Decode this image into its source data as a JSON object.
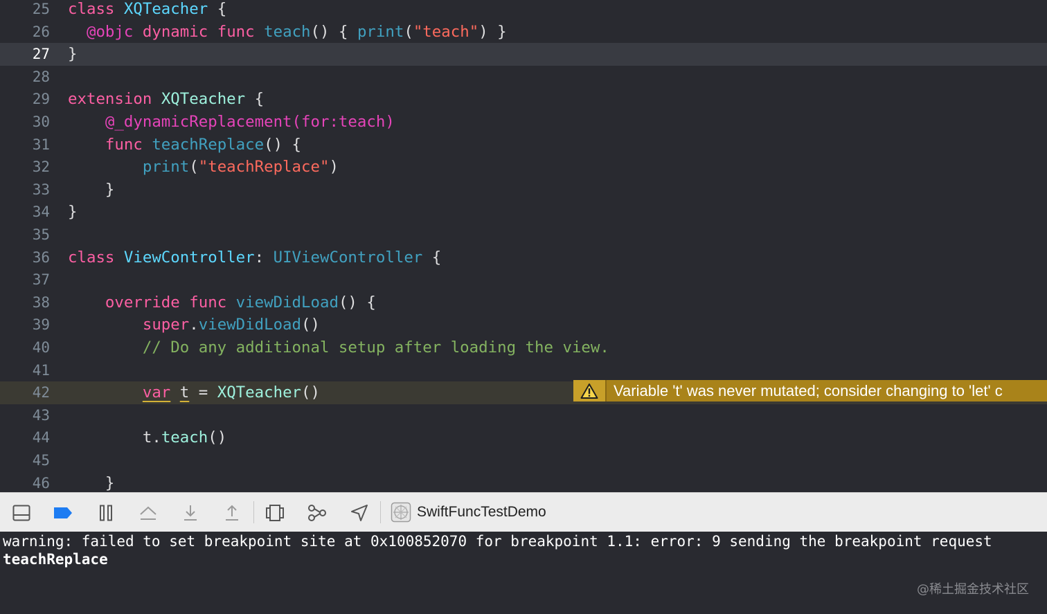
{
  "editor": {
    "lines": [
      {
        "num": "25",
        "tokens": [
          {
            "t": "class ",
            "c": "kw"
          },
          {
            "t": "XQTeacher",
            "c": "typedecl"
          },
          {
            "t": " {",
            "c": ""
          }
        ]
      },
      {
        "num": "26",
        "tokens": [
          {
            "t": "  ",
            "c": ""
          },
          {
            "t": "@objc",
            "c": "attr"
          },
          {
            "t": " ",
            "c": ""
          },
          {
            "t": "dynamic",
            "c": "kw"
          },
          {
            "t": " ",
            "c": ""
          },
          {
            "t": "func",
            "c": "kw"
          },
          {
            "t": " ",
            "c": ""
          },
          {
            "t": "teach",
            "c": "fnuse"
          },
          {
            "t": "() { ",
            "c": ""
          },
          {
            "t": "print",
            "c": "fnuse"
          },
          {
            "t": "(",
            "c": ""
          },
          {
            "t": "\"teach\"",
            "c": "str"
          },
          {
            "t": ") }",
            "c": ""
          }
        ]
      },
      {
        "num": "27",
        "tokens": [
          {
            "t": "}",
            "c": ""
          }
        ]
      },
      {
        "num": "28",
        "tokens": []
      },
      {
        "num": "29",
        "tokens": [
          {
            "t": "extension ",
            "c": "kw"
          },
          {
            "t": "XQTeacher",
            "c": "otype"
          },
          {
            "t": " {",
            "c": ""
          }
        ]
      },
      {
        "num": "30",
        "tokens": [
          {
            "t": "    ",
            "c": ""
          },
          {
            "t": "@_dynamicReplacement(for:teach)",
            "c": "attr"
          }
        ]
      },
      {
        "num": "31",
        "tokens": [
          {
            "t": "    ",
            "c": ""
          },
          {
            "t": "func",
            "c": "kw"
          },
          {
            "t": " ",
            "c": ""
          },
          {
            "t": "teachReplace",
            "c": "fnuse"
          },
          {
            "t": "() {",
            "c": ""
          }
        ]
      },
      {
        "num": "32",
        "tokens": [
          {
            "t": "        ",
            "c": ""
          },
          {
            "t": "print",
            "c": "fnuse"
          },
          {
            "t": "(",
            "c": ""
          },
          {
            "t": "\"teachReplace\"",
            "c": "str"
          },
          {
            "t": ")",
            "c": ""
          }
        ]
      },
      {
        "num": "33",
        "tokens": [
          {
            "t": "    }",
            "c": ""
          }
        ]
      },
      {
        "num": "34",
        "tokens": [
          {
            "t": "}",
            "c": ""
          }
        ]
      },
      {
        "num": "35",
        "tokens": []
      },
      {
        "num": "36",
        "tokens": [
          {
            "t": "class ",
            "c": "kw"
          },
          {
            "t": "ViewController",
            "c": "typedecl"
          },
          {
            "t": ": ",
            "c": ""
          },
          {
            "t": "UIViewController",
            "c": "fnuse"
          },
          {
            "t": " {",
            "c": ""
          }
        ]
      },
      {
        "num": "37",
        "tokens": []
      },
      {
        "num": "38",
        "tokens": [
          {
            "t": "    ",
            "c": ""
          },
          {
            "t": "override",
            "c": "kw"
          },
          {
            "t": " ",
            "c": ""
          },
          {
            "t": "func",
            "c": "kw"
          },
          {
            "t": " ",
            "c": ""
          },
          {
            "t": "viewDidLoad",
            "c": "fnuse"
          },
          {
            "t": "() {",
            "c": ""
          }
        ]
      },
      {
        "num": "39",
        "tokens": [
          {
            "t": "        ",
            "c": ""
          },
          {
            "t": "super",
            "c": "kw"
          },
          {
            "t": ".",
            "c": ""
          },
          {
            "t": "viewDidLoad",
            "c": "fnuse"
          },
          {
            "t": "()",
            "c": ""
          }
        ]
      },
      {
        "num": "40",
        "tokens": [
          {
            "t": "        ",
            "c": ""
          },
          {
            "t": "// Do any additional setup after loading the view.",
            "c": "cmt"
          }
        ]
      },
      {
        "num": "41",
        "tokens": []
      },
      {
        "num": "42",
        "tokens": [
          {
            "t": "        ",
            "c": ""
          },
          {
            "t": "var",
            "c": "kw warnu"
          },
          {
            "t": " ",
            "c": ""
          },
          {
            "t": "t",
            "c": "warnu"
          },
          {
            "t": " = ",
            "c": ""
          },
          {
            "t": "XQTeacher",
            "c": "otype"
          },
          {
            "t": "()",
            "c": ""
          }
        ]
      },
      {
        "num": "43",
        "tokens": []
      },
      {
        "num": "44",
        "tokens": [
          {
            "t": "        t.",
            "c": ""
          },
          {
            "t": "teach",
            "c": "otype"
          },
          {
            "t": "()",
            "c": ""
          }
        ]
      },
      {
        "num": "45",
        "tokens": []
      },
      {
        "num": "46",
        "tokens": [
          {
            "t": "    }",
            "c": ""
          }
        ]
      }
    ],
    "warning_message": "Variable 't' was never mutated; consider changing to 'let' c"
  },
  "toolbar": {
    "scheme_name": "SwiftFuncTestDemo"
  },
  "console": {
    "line1": "warning: failed to set breakpoint site at 0x100852070 for breakpoint 1.1: error: 9 sending the breakpoint request",
    "line2": "teachReplace"
  },
  "watermark": "@稀土掘金技术社区",
  "colors": {
    "editor_bg": "#292a30",
    "keyword": "#fc5fa3",
    "string": "#fc6a5d",
    "comment": "#84b360",
    "warning": "#a9831a"
  }
}
